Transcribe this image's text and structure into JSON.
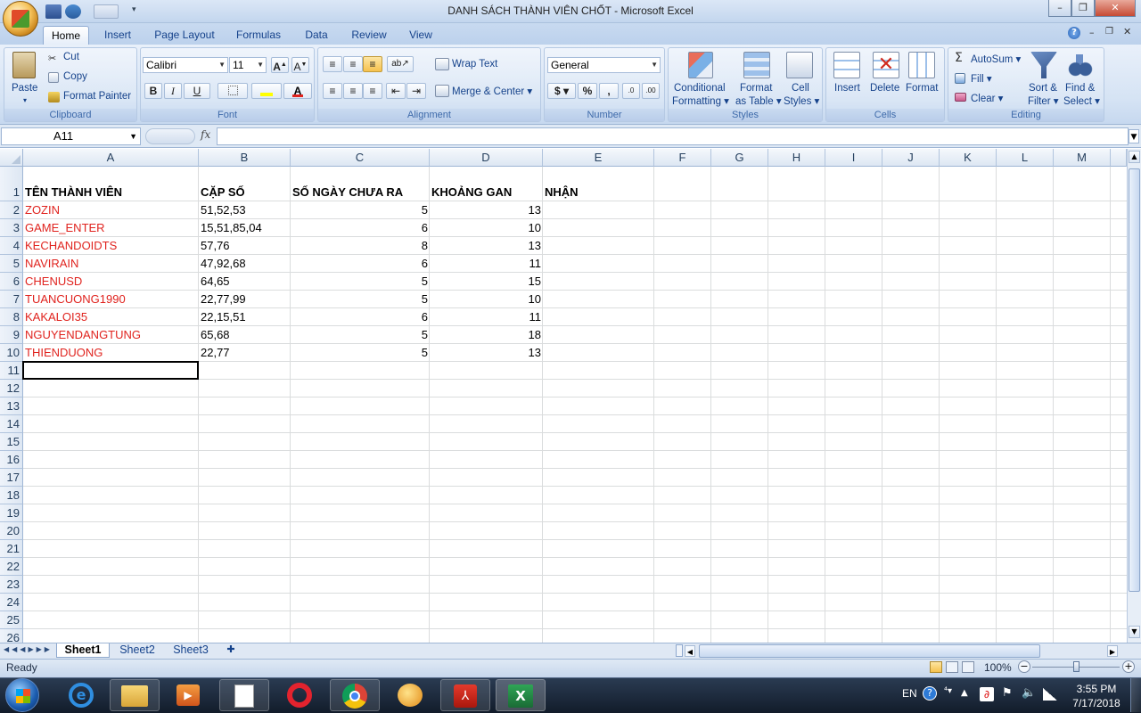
{
  "window": {
    "title": "DANH SÁCH THÀNH VIÊN CHỐT - Microsoft Excel"
  },
  "ribbon_tabs": [
    "Home",
    "Insert",
    "Page Layout",
    "Formulas",
    "Data",
    "Review",
    "View"
  ],
  "clipboard": {
    "paste": "Paste",
    "cut": "Cut",
    "copy": "Copy",
    "format_painter": "Format Painter",
    "label": "Clipboard"
  },
  "font": {
    "name": "Calibri",
    "size": "11",
    "bold": "B",
    "italic": "I",
    "underline": "U",
    "label": "Font"
  },
  "alignment": {
    "wrap_text": "Wrap Text",
    "merge_center": "Merge & Center",
    "label": "Alignment"
  },
  "number": {
    "format": "General",
    "currency": "$",
    "percent": "%",
    "comma": ",",
    "label": "Number"
  },
  "styles": {
    "conditional": "Conditional",
    "conditional2": "Formatting",
    "format_as": "Format",
    "format_as2": "as Table",
    "cell": "Cell",
    "cell2": "Styles",
    "label": "Styles"
  },
  "cells": {
    "insert": "Insert",
    "delete": "Delete",
    "format": "Format",
    "label": "Cells"
  },
  "editing": {
    "autosum": "AutoSum",
    "fill": "Fill",
    "clear": "Clear",
    "sort": "Sort &",
    "sort2": "Filter",
    "find": "Find &",
    "find2": "Select",
    "label": "Editing"
  },
  "formula_bar": {
    "name_box": "A11",
    "fx": "fx",
    "formula": ""
  },
  "columns": [
    "A",
    "B",
    "C",
    "D",
    "E",
    "F",
    "G",
    "H",
    "I",
    "J",
    "K",
    "L",
    "M"
  ],
  "row_numbers": [
    "1",
    "2",
    "3",
    "4",
    "5",
    "6",
    "7",
    "8",
    "9",
    "10",
    "11",
    "12",
    "13",
    "14",
    "15",
    "16",
    "17",
    "18",
    "19",
    "20",
    "21",
    "22",
    "23",
    "24",
    "25",
    "26"
  ],
  "headers": {
    "a": "TÊN THÀNH VIÊN",
    "b": "CẶP SỐ",
    "c": "SỐ NGÀY CHƯA RA",
    "d": "KHOẢNG GAN",
    "e": "NHẬN"
  },
  "rows": [
    {
      "name": "ZOZIN",
      "pair": "51,52,53",
      "days": "5",
      "gap": "13"
    },
    {
      "name": "GAME_ENTER",
      "pair": "15,51,85,04",
      "days": "6",
      "gap": "10"
    },
    {
      "name": "KECHANDOIDTS",
      "pair": "57,76",
      "days": "8",
      "gap": "13"
    },
    {
      "name": "NAVIRAIN",
      "pair": "47,92,68",
      "days": "6",
      "gap": "11"
    },
    {
      "name": "CHENUSD",
      "pair": "64,65",
      "days": "5",
      "gap": "15"
    },
    {
      "name": "TUANCUONG1990",
      "pair": "22,77,99",
      "days": "5",
      "gap": "10"
    },
    {
      "name": "KAKALOI35",
      "pair": "22,15,51",
      "days": "6",
      "gap": "11"
    },
    {
      "name": "NGUYENDANGTUNG",
      "pair": "65,68",
      "days": "5",
      "gap": "18"
    },
    {
      "name": "THIENDUONG",
      "pair": "22,77",
      "days": "5",
      "gap": "13"
    }
  ],
  "sheets": [
    "Sheet1",
    "Sheet2",
    "Sheet3"
  ],
  "status": {
    "ready": "Ready",
    "zoom": "100%"
  },
  "taskbar": {
    "language": "EN",
    "time": "3:55 PM",
    "date": "7/17/2018"
  },
  "colors": {
    "name_text": "#e0231e",
    "ribbon_text": "#15428b"
  }
}
